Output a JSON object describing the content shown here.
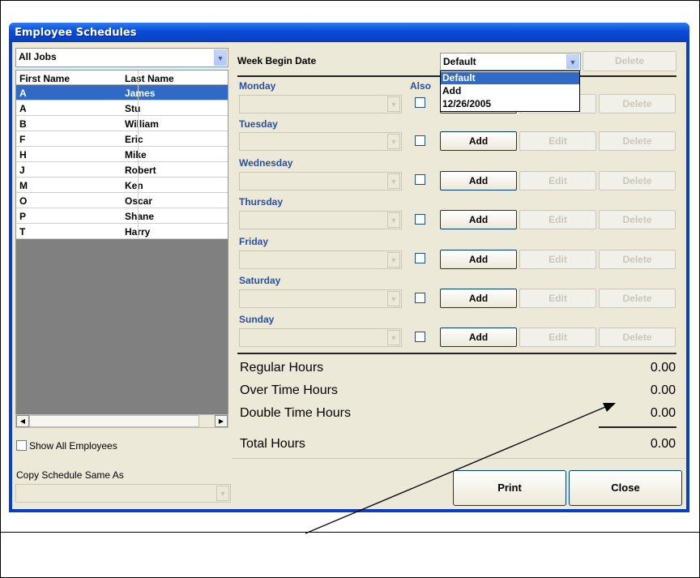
{
  "window": {
    "title": "Employee Schedules"
  },
  "jobs_filter": {
    "value": "All Jobs"
  },
  "employee_list": {
    "columns": [
      "First Name",
      "Last Name"
    ],
    "rows": [
      {
        "first": "A",
        "last": "James",
        "selected": true
      },
      {
        "first": "A",
        "last": "Stu"
      },
      {
        "first": "B",
        "last": "William"
      },
      {
        "first": "F",
        "last": "Eric"
      },
      {
        "first": "H",
        "last": "Mike"
      },
      {
        "first": "J",
        "last": "Robert"
      },
      {
        "first": "M",
        "last": "Ken"
      },
      {
        "first": "O",
        "last": "Oscar"
      },
      {
        "first": "P",
        "last": "Shane"
      },
      {
        "first": "T",
        "last": "Harry"
      }
    ]
  },
  "show_all_employees": {
    "label": "Show All Employees",
    "checked": false
  },
  "copy_schedule": {
    "label": "Copy Schedule Same As",
    "value": ""
  },
  "week": {
    "label": "Week Begin Date",
    "value": "Default",
    "delete_label": "Delete",
    "options": [
      "Default",
      "Add",
      "12/26/2005"
    ],
    "highlighted_option": "Default"
  },
  "also_label": "Also",
  "days": [
    {
      "name": "Monday"
    },
    {
      "name": "Tuesday"
    },
    {
      "name": "Wednesday"
    },
    {
      "name": "Thursday"
    },
    {
      "name": "Friday"
    },
    {
      "name": "Saturday"
    },
    {
      "name": "Sunday"
    }
  ],
  "day_buttons": {
    "add": "Add",
    "edit": "Edit",
    "delete": "Delete"
  },
  "totals": {
    "regular_label": "Regular Hours",
    "regular_value": "0.00",
    "overtime_label": "Over Time Hours",
    "overtime_value": "0.00",
    "double_label": "Double Time Hours",
    "double_value": "0.00",
    "total_label": "Total Hours",
    "total_value": "0.00"
  },
  "actions": {
    "print": "Print",
    "close": "Close"
  },
  "colors": {
    "title_bar": "#0a4bd6",
    "selection": "#316ac5",
    "client_bg": "#ece9d8",
    "day_label": "#2a4fa0"
  }
}
